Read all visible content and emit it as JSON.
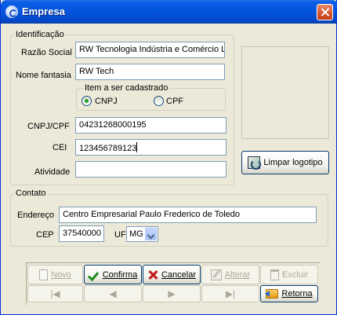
{
  "window": {
    "title": "Empresa"
  },
  "identificacao": {
    "legend": "Identificação",
    "razao_social_label": "Razão Social",
    "razao_social_value": "RW Tecnologia Indústria e Comércio L",
    "nome_fantasia_label": "Nome fantasia",
    "nome_fantasia_value": "RW Tech",
    "item_legend": "Item a ser cadastrado",
    "radio_cnpj": "CNPJ",
    "radio_cpf": "CPF",
    "cnpj_cpf_label": "CNPJ/CPF",
    "cnpj_cpf_value": "04231268000195",
    "cei_label": "CEI",
    "cei_value": "123456789123",
    "atividade_label": "Atividade",
    "atividade_value": ""
  },
  "logo": {
    "clear_button": "Limpar logotipo"
  },
  "contato": {
    "legend": "Contato",
    "endereco_label": "Endereço",
    "endereco_value": "Centro Empresarial Paulo Frederico de Toledo",
    "cep_label": "CEP",
    "cep_value": "37540000",
    "uf_label": "UF",
    "uf_value": "MG"
  },
  "buttons": {
    "novo": "Novo",
    "confirma": "Confirma",
    "cancelar": "Cancelar",
    "alterar": "Alterar",
    "excluir": "Excluir",
    "retorna": "Retorna",
    "first": "|◀",
    "prev": "◀",
    "next": "▶",
    "last": "▶|"
  }
}
